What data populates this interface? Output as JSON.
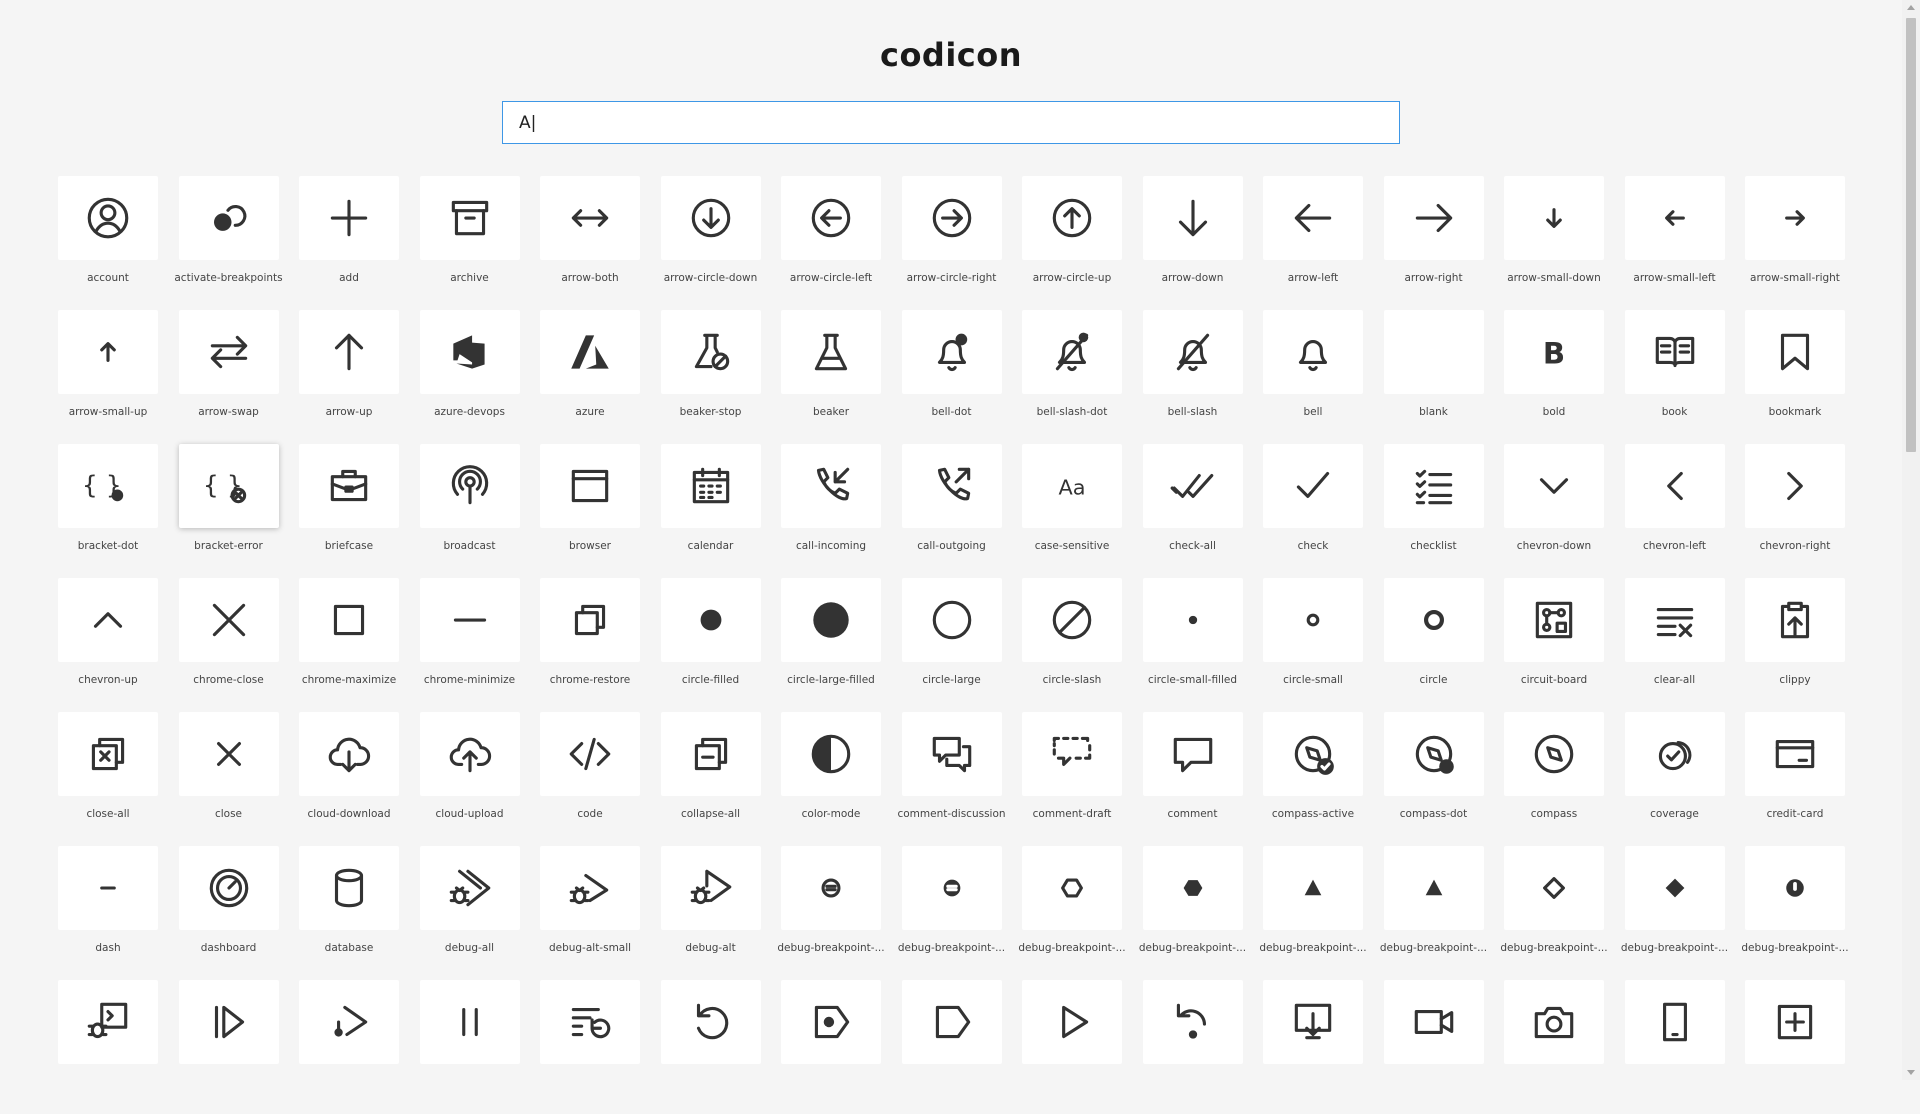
{
  "title": "codicon",
  "search": {
    "value": "A|",
    "placeholder": ""
  },
  "icons": [
    {
      "label": "account",
      "icon": "account-icon"
    },
    {
      "label": "activate-breakpoints",
      "icon": "activate-breakpoints-icon"
    },
    {
      "label": "add",
      "icon": "add-icon"
    },
    {
      "label": "archive",
      "icon": "archive-icon"
    },
    {
      "label": "arrow-both",
      "icon": "arrow-both-icon"
    },
    {
      "label": "arrow-circle-down",
      "icon": "arrow-circle-down-icon"
    },
    {
      "label": "arrow-circle-left",
      "icon": "arrow-circle-left-icon"
    },
    {
      "label": "arrow-circle-right",
      "icon": "arrow-circle-right-icon"
    },
    {
      "label": "arrow-circle-up",
      "icon": "arrow-circle-up-icon"
    },
    {
      "label": "arrow-down",
      "icon": "arrow-down-icon"
    },
    {
      "label": "arrow-left",
      "icon": "arrow-left-icon"
    },
    {
      "label": "arrow-right",
      "icon": "arrow-right-icon"
    },
    {
      "label": "arrow-small-down",
      "icon": "arrow-small-down-icon"
    },
    {
      "label": "arrow-small-left",
      "icon": "arrow-small-left-icon"
    },
    {
      "label": "arrow-small-right",
      "icon": "arrow-small-right-icon"
    },
    {
      "label": "arrow-small-up",
      "icon": "arrow-small-up-icon"
    },
    {
      "label": "arrow-swap",
      "icon": "arrow-swap-icon"
    },
    {
      "label": "arrow-up",
      "icon": "arrow-up-icon"
    },
    {
      "label": "azure-devops",
      "icon": "azure-devops-icon"
    },
    {
      "label": "azure",
      "icon": "azure-icon"
    },
    {
      "label": "beaker-stop",
      "icon": "beaker-stop-icon"
    },
    {
      "label": "beaker",
      "icon": "beaker-icon"
    },
    {
      "label": "bell-dot",
      "icon": "bell-dot-icon"
    },
    {
      "label": "bell-slash-dot",
      "icon": "bell-slash-dot-icon"
    },
    {
      "label": "bell-slash",
      "icon": "bell-slash-icon"
    },
    {
      "label": "bell",
      "icon": "bell-icon"
    },
    {
      "label": "blank",
      "icon": "blank-icon"
    },
    {
      "label": "bold",
      "icon": "bold-icon",
      "glyph": "B"
    },
    {
      "label": "book",
      "icon": "book-icon"
    },
    {
      "label": "bookmark",
      "icon": "bookmark-icon"
    },
    {
      "label": "bracket-dot",
      "icon": "bracket-dot-icon",
      "glyph": "{ }"
    },
    {
      "label": "bracket-error",
      "icon": "bracket-error-icon",
      "glyph": "{ }"
    },
    {
      "label": "briefcase",
      "icon": "briefcase-icon"
    },
    {
      "label": "broadcast",
      "icon": "broadcast-icon"
    },
    {
      "label": "browser",
      "icon": "browser-icon"
    },
    {
      "label": "calendar",
      "icon": "calendar-icon"
    },
    {
      "label": "call-incoming",
      "icon": "call-incoming-icon"
    },
    {
      "label": "call-outgoing",
      "icon": "call-outgoing-icon"
    },
    {
      "label": "case-sensitive",
      "icon": "case-sensitive-icon",
      "glyph": "Aa"
    },
    {
      "label": "check-all",
      "icon": "check-all-icon"
    },
    {
      "label": "check",
      "icon": "check-icon"
    },
    {
      "label": "checklist",
      "icon": "checklist-icon"
    },
    {
      "label": "chevron-down",
      "icon": "chevron-down-icon"
    },
    {
      "label": "chevron-left",
      "icon": "chevron-left-icon"
    },
    {
      "label": "chevron-right",
      "icon": "chevron-right-icon"
    },
    {
      "label": "chevron-up",
      "icon": "chevron-up-icon"
    },
    {
      "label": "chrome-close",
      "icon": "chrome-close-icon"
    },
    {
      "label": "chrome-maximize",
      "icon": "chrome-maximize-icon"
    },
    {
      "label": "chrome-minimize",
      "icon": "chrome-minimize-icon"
    },
    {
      "label": "chrome-restore",
      "icon": "chrome-restore-icon"
    },
    {
      "label": "circle-filled",
      "icon": "circle-filled-icon"
    },
    {
      "label": "circle-large-filled",
      "icon": "circle-large-filled-icon"
    },
    {
      "label": "circle-large",
      "icon": "circle-large-icon"
    },
    {
      "label": "circle-slash",
      "icon": "circle-slash-icon"
    },
    {
      "label": "circle-small-filled",
      "icon": "circle-small-filled-icon"
    },
    {
      "label": "circle-small",
      "icon": "circle-small-icon"
    },
    {
      "label": "circle",
      "icon": "circle-icon"
    },
    {
      "label": "circuit-board",
      "icon": "circuit-board-icon"
    },
    {
      "label": "clear-all",
      "icon": "clear-all-icon"
    },
    {
      "label": "clippy",
      "icon": "clippy-icon"
    },
    {
      "label": "close-all",
      "icon": "close-all-icon"
    },
    {
      "label": "close",
      "icon": "close-icon"
    },
    {
      "label": "cloud-download",
      "icon": "cloud-download-icon"
    },
    {
      "label": "cloud-upload",
      "icon": "cloud-upload-icon"
    },
    {
      "label": "code",
      "icon": "code-icon"
    },
    {
      "label": "collapse-all",
      "icon": "collapse-all-icon"
    },
    {
      "label": "color-mode",
      "icon": "color-mode-icon"
    },
    {
      "label": "comment-discussion",
      "icon": "comment-discussion-icon"
    },
    {
      "label": "comment-draft",
      "icon": "comment-draft-icon"
    },
    {
      "label": "comment",
      "icon": "comment-icon"
    },
    {
      "label": "compass-active",
      "icon": "compass-active-icon"
    },
    {
      "label": "compass-dot",
      "icon": "compass-dot-icon"
    },
    {
      "label": "compass",
      "icon": "compass-icon"
    },
    {
      "label": "coverage",
      "icon": "coverage-icon"
    },
    {
      "label": "credit-card",
      "icon": "credit-card-icon"
    },
    {
      "label": "dash",
      "icon": "dash-icon"
    },
    {
      "label": "dashboard",
      "icon": "dashboard-icon"
    },
    {
      "label": "database",
      "icon": "database-icon"
    },
    {
      "label": "debug-all",
      "icon": "debug-all-icon"
    },
    {
      "label": "debug-alt-small",
      "icon": "debug-alt-small-icon"
    },
    {
      "label": "debug-alt",
      "icon": "debug-alt-icon"
    },
    {
      "label": "debug-breakpoint-...",
      "icon": "debug-breakpoint-conditional-icon"
    },
    {
      "label": "debug-breakpoint-...",
      "icon": "debug-breakpoint-conditional-filled-icon"
    },
    {
      "label": "debug-breakpoint-...",
      "icon": "debug-breakpoint-data-icon"
    },
    {
      "label": "debug-breakpoint-...",
      "icon": "debug-breakpoint-data-filled-icon"
    },
    {
      "label": "debug-breakpoint-...",
      "icon": "debug-breakpoint-function-icon"
    },
    {
      "label": "debug-breakpoint-...",
      "icon": "debug-breakpoint-function-filled-icon"
    },
    {
      "label": "debug-breakpoint-...",
      "icon": "debug-breakpoint-log-icon"
    },
    {
      "label": "debug-breakpoint-...",
      "icon": "debug-breakpoint-log-filled-icon"
    },
    {
      "label": "debug-breakpoint-...",
      "icon": "debug-breakpoint-unsupported-icon"
    },
    {
      "label": "",
      "icon": "debug-console-icon"
    },
    {
      "label": "",
      "icon": "debug-continue-icon"
    },
    {
      "label": "",
      "icon": "debug-coverage-icon"
    },
    {
      "label": "",
      "icon": "debug-pause-icon"
    },
    {
      "label": "",
      "icon": "debug-rerun-icon"
    },
    {
      "label": "",
      "icon": "debug-restart-icon"
    },
    {
      "label": "",
      "icon": "debug-stackframe-active-icon"
    },
    {
      "label": "",
      "icon": "debug-stackframe-icon"
    },
    {
      "label": "",
      "icon": "debug-start-icon"
    },
    {
      "label": "",
      "icon": "debug-step-back-icon"
    },
    {
      "label": "",
      "icon": "desktop-download-icon"
    },
    {
      "label": "",
      "icon": "device-camera-video-icon"
    },
    {
      "label": "",
      "icon": "device-camera-icon"
    },
    {
      "label": "",
      "icon": "device-mobile-icon"
    },
    {
      "label": "",
      "icon": "diff-added-icon"
    }
  ]
}
